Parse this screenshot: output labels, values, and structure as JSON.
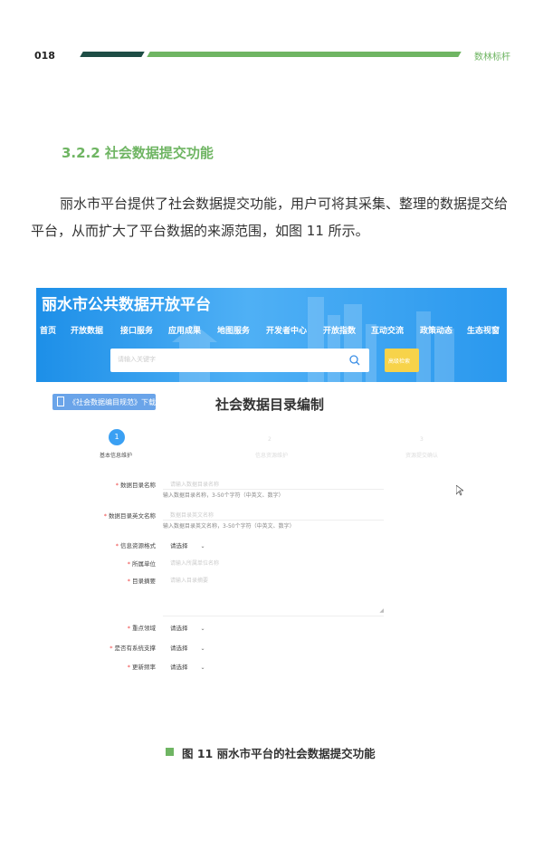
{
  "header": {
    "page_number": "018",
    "brand": "数林标杆"
  },
  "section": {
    "title": "3.2.2 社会数据提交功能",
    "paragraph": "丽水市平台提供了社会数据提交功能，用户可将其采集、整理的数据提交给平台，从而扩大了平台数据的来源范围，如图 11 所示。"
  },
  "screenshot": {
    "site_title": "丽水市公共数据开放平台",
    "nav": [
      "首页",
      "开放数据",
      "接口服务",
      "应用成果",
      "地图服务",
      "开发者中心",
      "开放指数",
      "互动交流",
      "政策动态",
      "生态视窗"
    ],
    "search_placeholder": "请输入关键字",
    "search_button": "高级检索",
    "spec_link": "《社会数据编目规范》下载",
    "page_heading": "社会数据目录编制",
    "steps": [
      {
        "num": "1",
        "label": "基本信息维护",
        "active": true
      },
      {
        "num": "2",
        "label": "信息资源维护",
        "active": false
      },
      {
        "num": "3",
        "label": "资源提交确认",
        "active": false
      }
    ],
    "fields": {
      "name": {
        "label": "数据目录名称",
        "placeholder": "请输入数据目录名称",
        "hint": "输入数据目录名称，3-50个字符（中英文、数字）"
      },
      "en_name": {
        "label": "数据目录英文名称",
        "placeholder": "数据目录英文名称",
        "hint": "输入数据目录英文名称，3-50个字符（中英文、数字）"
      },
      "format": {
        "label": "信息资源格式",
        "value": "请选择"
      },
      "unit": {
        "label": "所属单位",
        "placeholder": "请输入所属单位名称"
      },
      "summary": {
        "label": "目录摘要",
        "placeholder": "请输入目录摘要"
      },
      "domain": {
        "label": "重点领域",
        "value": "请选择"
      },
      "system": {
        "label": "是否有系统支撑",
        "value": "请选择"
      },
      "freq": {
        "label": "更新频率",
        "value": "请选择"
      }
    }
  },
  "caption": "图 11  丽水市平台的社会数据提交功能",
  "colors": {
    "accent_green": "#6fb563",
    "dark_green": "#1e4d45",
    "banner_blue": "#2a98ee",
    "step_blue": "#3aa0f3"
  }
}
